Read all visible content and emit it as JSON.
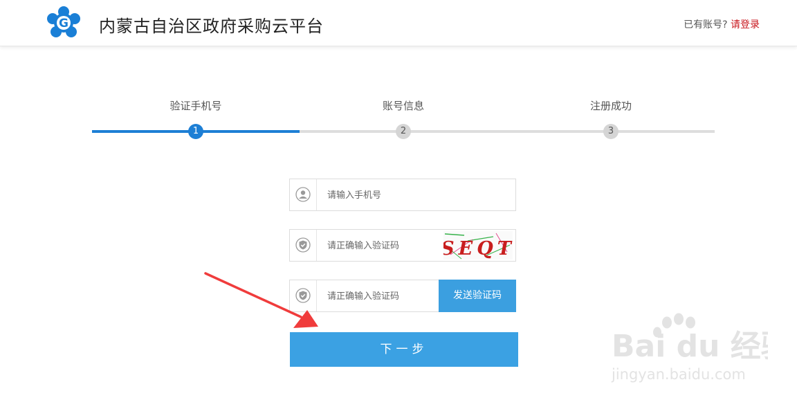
{
  "header": {
    "site_title": "内蒙古自治区政府采购云平台",
    "login_prompt": "已有账号?",
    "login_link": "请登录"
  },
  "steps": [
    {
      "label": "验证手机号",
      "number": "1",
      "state": "active"
    },
    {
      "label": "账号信息",
      "number": "2",
      "state": "inactive"
    },
    {
      "label": "注册成功",
      "number": "3",
      "state": "inactive"
    }
  ],
  "form": {
    "phone_placeholder": "请输入手机号",
    "captcha_placeholder": "请正确输入验证码",
    "captcha_text": "SEQT",
    "sms_placeholder": "请正确输入验证码",
    "send_code_label": "发送验证码",
    "next_label": "下一步"
  },
  "watermark": {
    "brand_text": "Bai du 经验",
    "url": "jingyan.baidu.com"
  },
  "colors": {
    "accent_blue": "#1d7fd5",
    "button_blue": "#3ba1e3",
    "login_red": "#c8161d",
    "arrow_red": "#f03c3c"
  }
}
